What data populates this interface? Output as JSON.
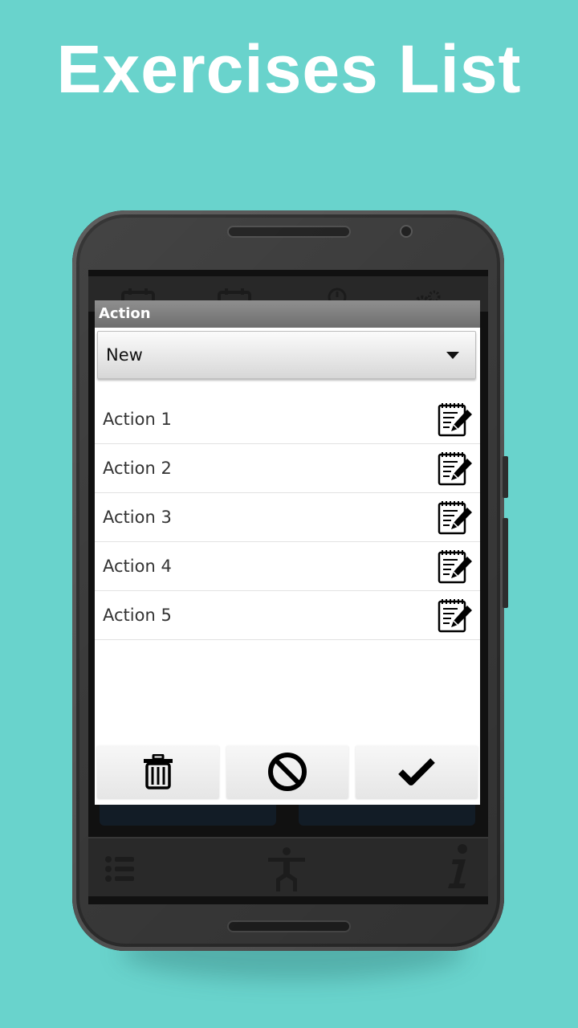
{
  "headline": "Exercises List",
  "dialog": {
    "title": "Action",
    "dropdown": {
      "selected": "New"
    },
    "items": [
      {
        "label": "Action 1"
      },
      {
        "label": "Action 2"
      },
      {
        "label": "Action 3"
      },
      {
        "label": "Action 4"
      },
      {
        "label": "Action 5"
      }
    ],
    "buttons": [
      {
        "icon": "trash-icon"
      },
      {
        "icon": "cancel-icon"
      },
      {
        "icon": "check-icon"
      }
    ]
  },
  "background_app": {
    "top_icons": [
      "calendar-day-icon",
      "calendar-month-icon",
      "stopwatch-icon",
      "gears-icon"
    ],
    "bottom_icons": [
      "list-icon",
      "person-icon",
      "info-icon"
    ]
  },
  "colors": {
    "background": "#69d3cc",
    "headline": "#ffffff",
    "dialog_title_bar": "#7f7f7f",
    "phone_body": "#3a3a3a"
  }
}
